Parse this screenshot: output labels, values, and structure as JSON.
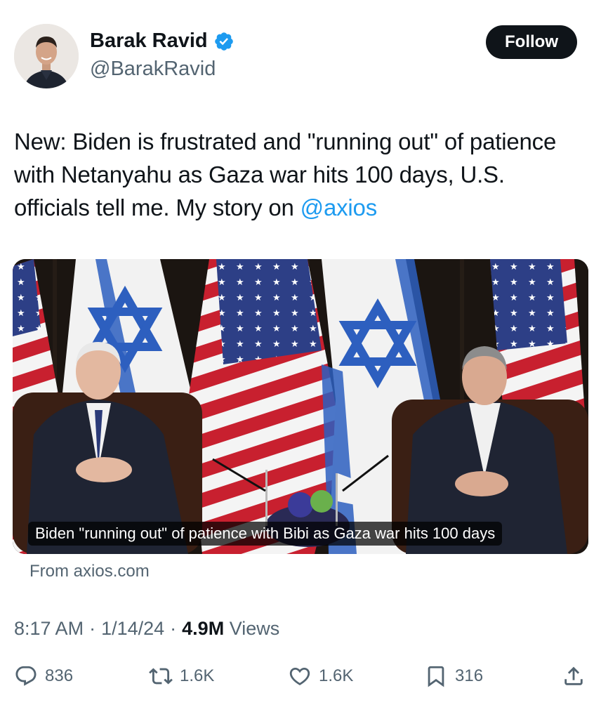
{
  "author": {
    "name": "Barak Ravid",
    "handle": "@BarakRavid",
    "verified": true
  },
  "follow_label": "Follow",
  "tweet": {
    "text_main": "New: Biden is frustrated and \"running out\" of patience with Netanyahu as Gaza war hits 100 days, U.S. officials tell me. My story on ",
    "mention": "@axios"
  },
  "card": {
    "caption": "Biden \"running out\" of patience with Bibi as Gaza war hits 100 days",
    "source": "From axios.com"
  },
  "meta": {
    "time": "8:17 AM",
    "separator": "·",
    "date": "1/14/24",
    "views_count": "4.9M",
    "views_label": "Views"
  },
  "actions": {
    "replies": "836",
    "reposts": "1.6K",
    "likes": "1.6K",
    "bookmarks": "316"
  },
  "colors": {
    "accent": "#1d9bf0",
    "text": "#0f1419",
    "secondary": "#536471"
  }
}
